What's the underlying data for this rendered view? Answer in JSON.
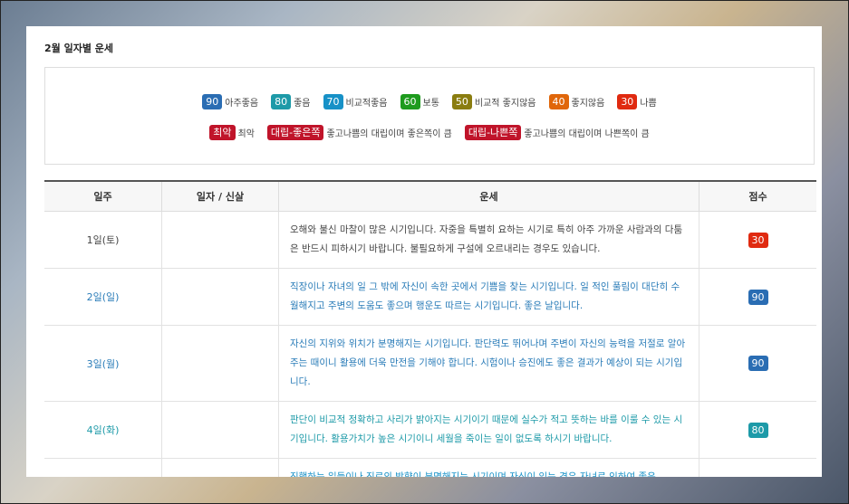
{
  "title": "2월 일자별 운세",
  "legend": {
    "row1": [
      {
        "badge": "90",
        "label": "아주좋음",
        "color": "#2a6db3"
      },
      {
        "badge": "80",
        "label": "좋음",
        "color": "#1d9aa8"
      },
      {
        "badge": "70",
        "label": "비교적좋음",
        "color": "#1791c7"
      },
      {
        "badge": "60",
        "label": "보통",
        "color": "#1e9b1e"
      },
      {
        "badge": "50",
        "label": "비교적 좋지않음",
        "color": "#8a7d10"
      },
      {
        "badge": "40",
        "label": "좋지않음",
        "color": "#e0660a"
      },
      {
        "badge": "30",
        "label": "나쁨",
        "color": "#e02a10"
      }
    ],
    "row2": [
      {
        "badge": "최악",
        "label": "최악",
        "color": "#c0142a"
      },
      {
        "badge": "대립-좋은쪽",
        "label": "좋고나쁨의 대립이며 좋은쪽이 큼",
        "color": "#c0142a"
      },
      {
        "badge": "대립-나쁜쪽",
        "label": "좋고나쁨의 대립이며 나쁜쪽이 큼",
        "color": "#c0142a"
      }
    ]
  },
  "table": {
    "headers": [
      "일주",
      "일자 / 신살",
      "운세",
      "점수"
    ],
    "rows": [
      {
        "day": "1일(토)",
        "note": "",
        "fortune": "오해와 불신 마찰이 많은 시기입니다. 자중을 특별히 요하는 시기로 특히 아주 가까운 사람과의 다툼은 반드시 피하시기 바랍니다. 불필요하게 구설에 오르내리는 경우도 있습니다.",
        "score": "30",
        "text_color": "#444",
        "badge_color": "#e02a10"
      },
      {
        "day": "2일(일)",
        "note": "",
        "fortune": "직장이나 자녀의 일 그 밖에 자신이 속한 곳에서 기쁨을 찾는 시기입니다. 일 적인 풀림이 대단히 수월해지고 주변의 도움도 좋으며 행운도 따르는 시기입니다. 좋은 날입니다.",
        "score": "90",
        "text_color": "#2a7cb8",
        "badge_color": "#2a6db3"
      },
      {
        "day": "3일(월)",
        "note": "",
        "fortune": "자신의 지위와 위치가 분명해지는 시기입니다. 판단력도 뛰어나며 주변이 자신의 능력을 저절로 알아주는 때이니 활용에 더욱 만전을 기해야 합니다. 시험이나 승진에도 좋은 결과가 예상이 되는 시기입니다.",
        "score": "90",
        "text_color": "#2a7cb8",
        "badge_color": "#2a6db3"
      },
      {
        "day": "4일(화)",
        "note": "",
        "fortune": "판단이 비교적 정확하고 사리가 밝아지는 시기이기 때문에 실수가 적고 뜻하는 바를 이룰 수 있는 시기입니다. 활용가치가 높은 시기이니 세월을 죽이는 일이 없도록 하시기 바랍니다.",
        "score": "80",
        "text_color": "#1d9aa8",
        "badge_color": "#1d9aa8"
      },
      {
        "day": "",
        "note": "",
        "fortune": "진행하는 일들이나 진로의 방향이 분명해지는 시기이며 자신이 있는 경우 자녀로 인하여 좋은",
        "score": "",
        "text_color": "#1791c7",
        "badge_color": "#1791c7"
      }
    ]
  }
}
